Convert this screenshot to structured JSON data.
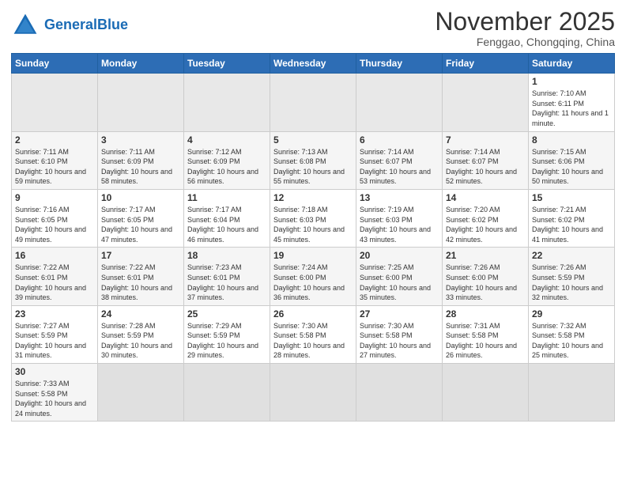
{
  "header": {
    "logo_general": "General",
    "logo_blue": "Blue",
    "month_title": "November 2025",
    "subtitle": "Fenggao, Chongqing, China"
  },
  "weekdays": [
    "Sunday",
    "Monday",
    "Tuesday",
    "Wednesday",
    "Thursday",
    "Friday",
    "Saturday"
  ],
  "weeks": [
    [
      {
        "day": "",
        "info": ""
      },
      {
        "day": "",
        "info": ""
      },
      {
        "day": "",
        "info": ""
      },
      {
        "day": "",
        "info": ""
      },
      {
        "day": "",
        "info": ""
      },
      {
        "day": "",
        "info": ""
      },
      {
        "day": "1",
        "info": "Sunrise: 7:10 AM\nSunset: 6:11 PM\nDaylight: 11 hours and 1 minute."
      }
    ],
    [
      {
        "day": "2",
        "info": "Sunrise: 7:11 AM\nSunset: 6:10 PM\nDaylight: 10 hours and 59 minutes."
      },
      {
        "day": "3",
        "info": "Sunrise: 7:11 AM\nSunset: 6:09 PM\nDaylight: 10 hours and 58 minutes."
      },
      {
        "day": "4",
        "info": "Sunrise: 7:12 AM\nSunset: 6:09 PM\nDaylight: 10 hours and 56 minutes."
      },
      {
        "day": "5",
        "info": "Sunrise: 7:13 AM\nSunset: 6:08 PM\nDaylight: 10 hours and 55 minutes."
      },
      {
        "day": "6",
        "info": "Sunrise: 7:14 AM\nSunset: 6:07 PM\nDaylight: 10 hours and 53 minutes."
      },
      {
        "day": "7",
        "info": "Sunrise: 7:14 AM\nSunset: 6:07 PM\nDaylight: 10 hours and 52 minutes."
      },
      {
        "day": "8",
        "info": "Sunrise: 7:15 AM\nSunset: 6:06 PM\nDaylight: 10 hours and 50 minutes."
      }
    ],
    [
      {
        "day": "9",
        "info": "Sunrise: 7:16 AM\nSunset: 6:05 PM\nDaylight: 10 hours and 49 minutes."
      },
      {
        "day": "10",
        "info": "Sunrise: 7:17 AM\nSunset: 6:05 PM\nDaylight: 10 hours and 47 minutes."
      },
      {
        "day": "11",
        "info": "Sunrise: 7:17 AM\nSunset: 6:04 PM\nDaylight: 10 hours and 46 minutes."
      },
      {
        "day": "12",
        "info": "Sunrise: 7:18 AM\nSunset: 6:03 PM\nDaylight: 10 hours and 45 minutes."
      },
      {
        "day": "13",
        "info": "Sunrise: 7:19 AM\nSunset: 6:03 PM\nDaylight: 10 hours and 43 minutes."
      },
      {
        "day": "14",
        "info": "Sunrise: 7:20 AM\nSunset: 6:02 PM\nDaylight: 10 hours and 42 minutes."
      },
      {
        "day": "15",
        "info": "Sunrise: 7:21 AM\nSunset: 6:02 PM\nDaylight: 10 hours and 41 minutes."
      }
    ],
    [
      {
        "day": "16",
        "info": "Sunrise: 7:22 AM\nSunset: 6:01 PM\nDaylight: 10 hours and 39 minutes."
      },
      {
        "day": "17",
        "info": "Sunrise: 7:22 AM\nSunset: 6:01 PM\nDaylight: 10 hours and 38 minutes."
      },
      {
        "day": "18",
        "info": "Sunrise: 7:23 AM\nSunset: 6:01 PM\nDaylight: 10 hours and 37 minutes."
      },
      {
        "day": "19",
        "info": "Sunrise: 7:24 AM\nSunset: 6:00 PM\nDaylight: 10 hours and 36 minutes."
      },
      {
        "day": "20",
        "info": "Sunrise: 7:25 AM\nSunset: 6:00 PM\nDaylight: 10 hours and 35 minutes."
      },
      {
        "day": "21",
        "info": "Sunrise: 7:26 AM\nSunset: 6:00 PM\nDaylight: 10 hours and 33 minutes."
      },
      {
        "day": "22",
        "info": "Sunrise: 7:26 AM\nSunset: 5:59 PM\nDaylight: 10 hours and 32 minutes."
      }
    ],
    [
      {
        "day": "23",
        "info": "Sunrise: 7:27 AM\nSunset: 5:59 PM\nDaylight: 10 hours and 31 minutes."
      },
      {
        "day": "24",
        "info": "Sunrise: 7:28 AM\nSunset: 5:59 PM\nDaylight: 10 hours and 30 minutes."
      },
      {
        "day": "25",
        "info": "Sunrise: 7:29 AM\nSunset: 5:59 PM\nDaylight: 10 hours and 29 minutes."
      },
      {
        "day": "26",
        "info": "Sunrise: 7:30 AM\nSunset: 5:58 PM\nDaylight: 10 hours and 28 minutes."
      },
      {
        "day": "27",
        "info": "Sunrise: 7:30 AM\nSunset: 5:58 PM\nDaylight: 10 hours and 27 minutes."
      },
      {
        "day": "28",
        "info": "Sunrise: 7:31 AM\nSunset: 5:58 PM\nDaylight: 10 hours and 26 minutes."
      },
      {
        "day": "29",
        "info": "Sunrise: 7:32 AM\nSunset: 5:58 PM\nDaylight: 10 hours and 25 minutes."
      }
    ],
    [
      {
        "day": "30",
        "info": "Sunrise: 7:33 AM\nSunset: 5:58 PM\nDaylight: 10 hours and 24 minutes."
      },
      {
        "day": "",
        "info": ""
      },
      {
        "day": "",
        "info": ""
      },
      {
        "day": "",
        "info": ""
      },
      {
        "day": "",
        "info": ""
      },
      {
        "day": "",
        "info": ""
      },
      {
        "day": "",
        "info": ""
      }
    ]
  ]
}
